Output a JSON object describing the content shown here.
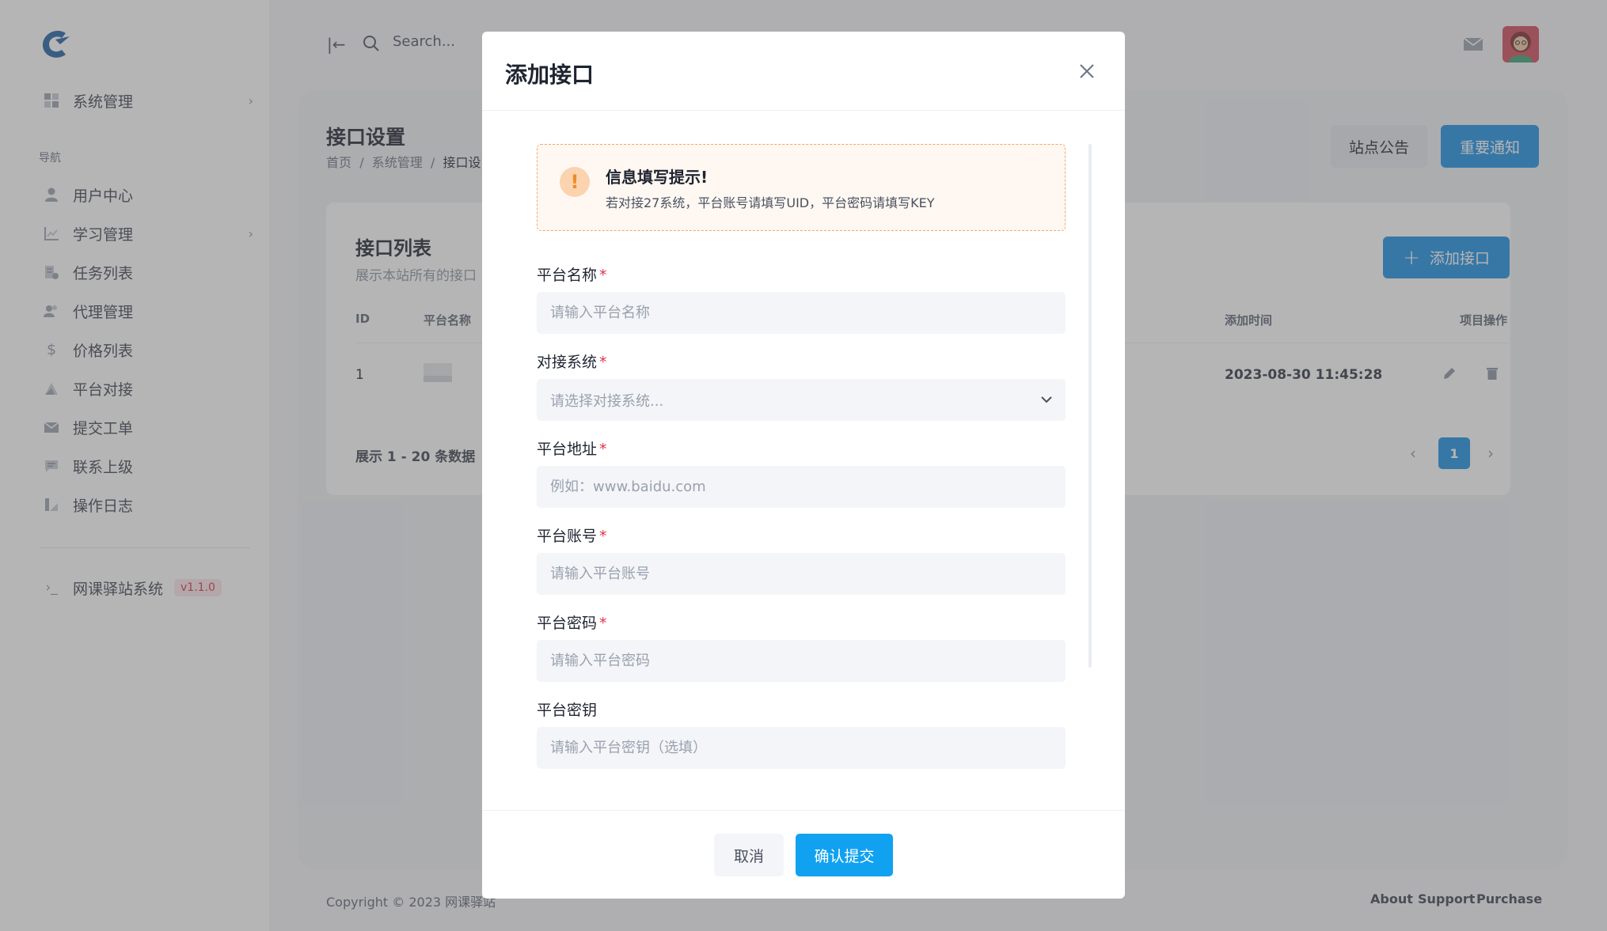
{
  "topbar": {
    "search_placeholder": "Search..."
  },
  "sidebar": {
    "items": [
      {
        "label": "系统管理",
        "icon": "grid-icon"
      },
      {
        "label": "用户中心",
        "icon": "user-icon"
      },
      {
        "label": "学习管理",
        "icon": "chart-icon"
      },
      {
        "label": "任务列表",
        "icon": "tasks-icon"
      },
      {
        "label": "代理管理",
        "icon": "users-icon"
      },
      {
        "label": "价格列表",
        "icon": "dollar-icon"
      },
      {
        "label": "平台对接",
        "icon": "connect-icon"
      },
      {
        "label": "提交工单",
        "icon": "mail-icon"
      },
      {
        "label": "联系上级",
        "icon": "message-icon"
      },
      {
        "label": "操作日志",
        "icon": "log-icon"
      }
    ],
    "section_heading": "导航",
    "system_name": "网课驿站系统",
    "version": "v1.1.0"
  },
  "header": {
    "title": "接口设置",
    "breadcrumb": [
      "首页",
      "系统管理",
      "接口设"
    ],
    "notice_button": "站点公告",
    "important_button": "重要通知"
  },
  "list": {
    "title": "接口列表",
    "subtitle": "展示本站所有的接口",
    "add_button": "添加接口",
    "columns": [
      "ID",
      "平台名称",
      "添加时间",
      "项目操作"
    ],
    "rows": [
      {
        "id": "1",
        "added_time": "2023-08-30 11:45:28"
      }
    ],
    "pager_info": "展示 1 - 20 条数据",
    "current_page": "1"
  },
  "footer": {
    "copyright": "Copyright © 2023 网课驿站",
    "links": [
      "About",
      "Support",
      "Purchase"
    ]
  },
  "modal": {
    "title": "添加接口",
    "alert_title": "信息填写提示!",
    "alert_text": "若对接27系统，平台账号请填写UID，平台密码请填写KEY",
    "fields": [
      {
        "label": "平台名称",
        "placeholder": "请输入平台名称",
        "required": true
      },
      {
        "label": "对接系统",
        "placeholder": "请选择对接系统...",
        "required": true
      },
      {
        "label": "平台地址",
        "placeholder": "例如：www.baidu.com",
        "required": true
      },
      {
        "label": "平台账号",
        "placeholder": "请输入平台账号",
        "required": true
      },
      {
        "label": "平台密码",
        "placeholder": "请输入平台密码",
        "required": true
      },
      {
        "label": "平台密钥",
        "placeholder": "请输入平台密钥（选填）",
        "required": false
      }
    ],
    "required_mark": "*",
    "cancel_button": "取消",
    "submit_button": "确认提交"
  },
  "colors": {
    "primary": "#1b8fe3",
    "submit": "#10a2f0",
    "required": "#e0334c",
    "alert_border": "#f0a868"
  }
}
